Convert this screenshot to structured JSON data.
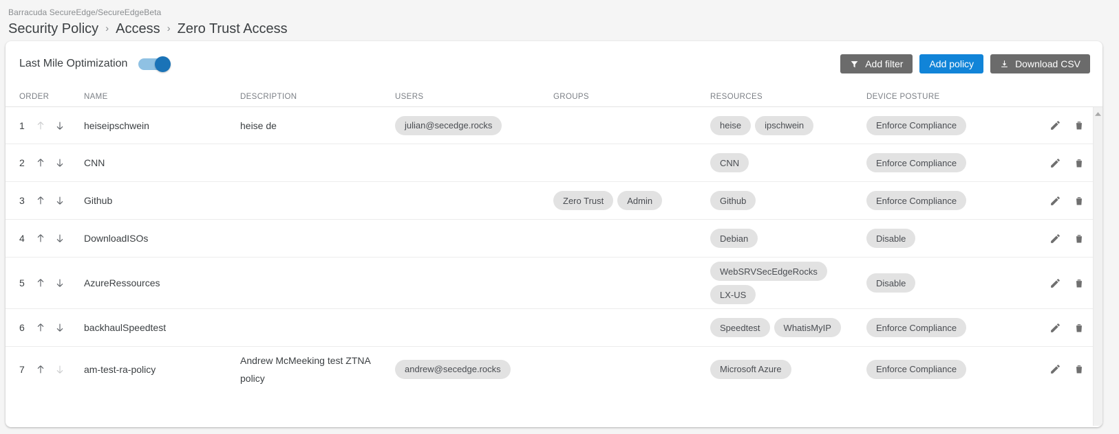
{
  "header": {
    "breadcrumb_small": "Barracuda SecureEdge/SecureEdgeBeta",
    "crumb1": "Security Policy",
    "crumb2": "Access",
    "crumb3": "Zero Trust Access",
    "sep": "›"
  },
  "toolbar": {
    "last_mile_label": "Last Mile Optimization",
    "last_mile_enabled": true,
    "add_filter_label": "Add filter",
    "add_policy_label": "Add policy",
    "download_csv_label": "Download CSV",
    "accent_blue": "#1184d8",
    "grey_button": "#6b6b6b"
  },
  "table": {
    "columns": [
      "ORDER",
      "NAME",
      "DESCRIPTION",
      "USERS",
      "GROUPS",
      "RESOURCES",
      "DEVICE POSTURE"
    ],
    "rows": [
      {
        "order": "1",
        "up_enabled": false,
        "down_enabled": true,
        "name": "heiseipschwein",
        "description": "heise de",
        "users": [
          "julian@secedge.rocks"
        ],
        "groups": [],
        "resources": [
          "heise",
          "ipschwein"
        ],
        "device_posture": [
          "Enforce Compliance"
        ]
      },
      {
        "order": "2",
        "up_enabled": true,
        "down_enabled": true,
        "name": "CNN",
        "description": "",
        "users": [],
        "groups": [],
        "resources": [
          "CNN"
        ],
        "device_posture": [
          "Enforce Compliance"
        ]
      },
      {
        "order": "3",
        "up_enabled": true,
        "down_enabled": true,
        "name": "Github",
        "description": "",
        "users": [],
        "groups": [
          "Zero Trust",
          "Admin"
        ],
        "resources": [
          "Github"
        ],
        "device_posture": [
          "Enforce Compliance"
        ]
      },
      {
        "order": "4",
        "up_enabled": true,
        "down_enabled": true,
        "name": "DownloadISOs",
        "description": "",
        "users": [],
        "groups": [],
        "resources": [
          "Debian"
        ],
        "device_posture": [
          "Disable"
        ]
      },
      {
        "order": "5",
        "up_enabled": true,
        "down_enabled": true,
        "name": "AzureRessources",
        "description": "",
        "users": [],
        "groups": [],
        "resources": [
          "WebSRVSecEdgeRocks",
          "LX-US"
        ],
        "device_posture": [
          "Disable"
        ]
      },
      {
        "order": "6",
        "up_enabled": true,
        "down_enabled": true,
        "name": "backhaulSpeedtest",
        "description": "",
        "users": [],
        "groups": [],
        "resources": [
          "Speedtest",
          "WhatisMyIP"
        ],
        "device_posture": [
          "Enforce Compliance"
        ]
      },
      {
        "order": "7",
        "up_enabled": true,
        "down_enabled": false,
        "name": "am-test-ra-policy",
        "description": "Andrew McMeeking test ZTNA policy",
        "users": [
          "andrew@secedge.rocks"
        ],
        "groups": [],
        "resources": [
          "Microsoft Azure"
        ],
        "device_posture": [
          "Enforce Compliance"
        ]
      }
    ],
    "row_actions": {
      "edit": "edit-icon",
      "delete": "delete-icon"
    }
  },
  "scrollbar": {
    "up_arrow": "scroll-up-arrow"
  }
}
